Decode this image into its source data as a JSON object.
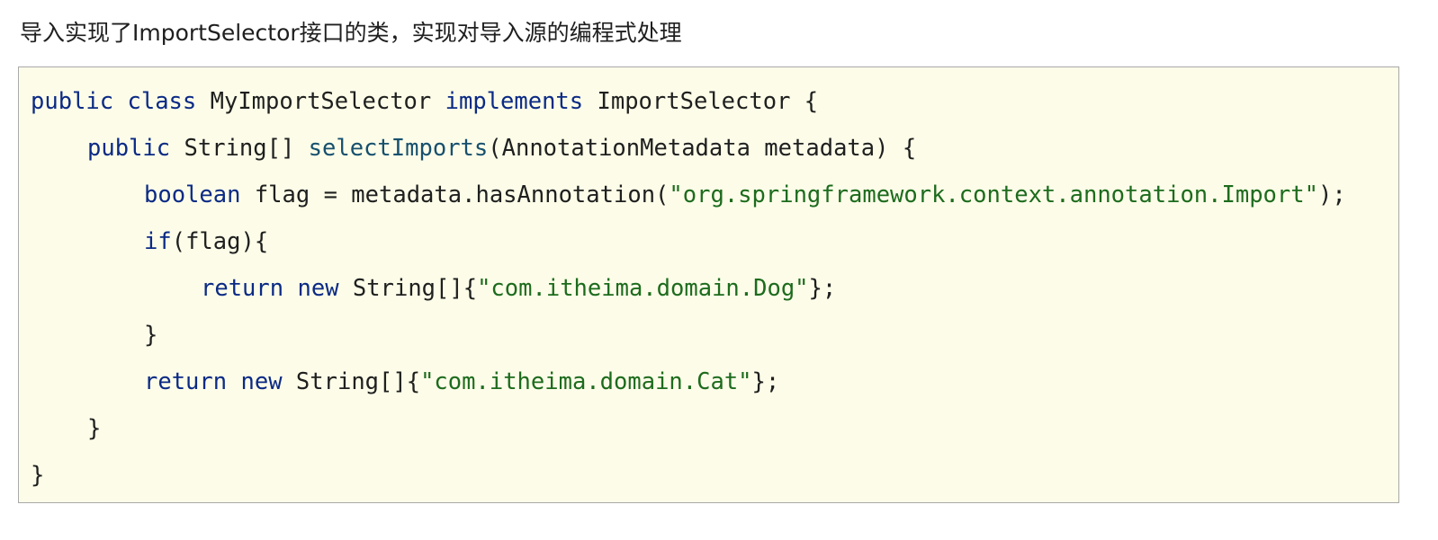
{
  "heading": "导入实现了ImportSelector接口的类，实现对导入源的编程式处理",
  "code": {
    "line1": {
      "kw1": "public",
      "kw2": "class",
      "name": "MyImportSelector",
      "kw3": "implements",
      "iface": "ImportSelector",
      "brace": "{"
    },
    "line2": {
      "kw1": "public",
      "type": "String[]",
      "method": "selectImports",
      "params": "(AnnotationMetadata metadata) {"
    },
    "line3": {
      "kw": "boolean",
      "pre": "flag = metadata.hasAnnotation(",
      "str": "\"org.springframework.context.annotation.Import\"",
      "post": ");"
    },
    "line4": {
      "kw": "if",
      "rest": "(flag){"
    },
    "line5": {
      "kw1": "return",
      "kw2": "new",
      "pre": "String[]{",
      "str": "\"com.itheima.domain.Dog\"",
      "post": "};"
    },
    "line6": {
      "text": "}"
    },
    "line7": {
      "kw1": "return",
      "kw2": "new",
      "pre": "String[]{",
      "str": "\"com.itheima.domain.Cat\"",
      "post": "};"
    },
    "line8": {
      "text": "}"
    },
    "line9": {
      "text": "}"
    }
  }
}
